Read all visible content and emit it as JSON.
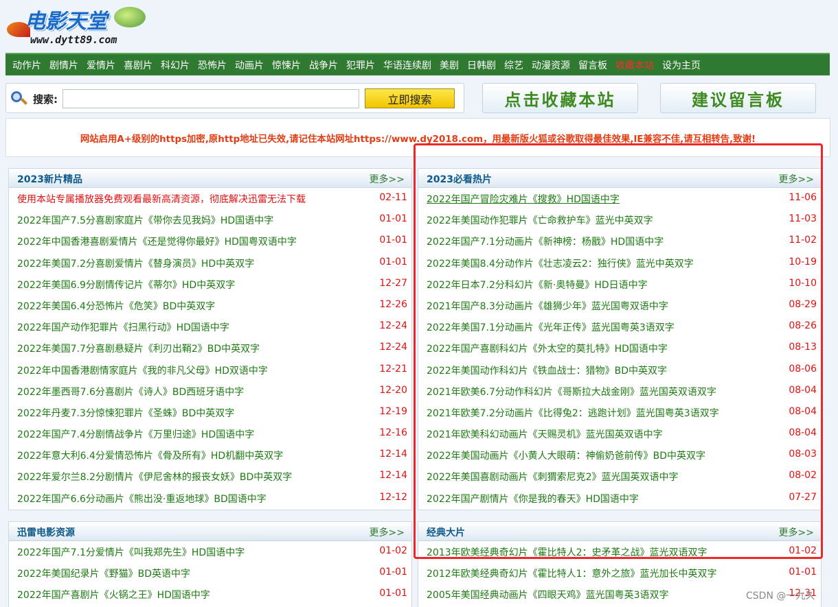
{
  "logo": {
    "title": "电影天堂",
    "url": "www.dytt89.com"
  },
  "nav": [
    "动作片",
    "剧情片",
    "爱情片",
    "喜剧片",
    "科幻片",
    "恐怖片",
    "动画片",
    "惊悚片",
    "战争片",
    "犯罪片",
    "华语连续剧",
    "美剧",
    "日韩剧",
    "综艺",
    "动漫资源",
    "留言板",
    "收藏本站",
    "设为主页"
  ],
  "search": {
    "label": "搜索:",
    "value": "",
    "button": "立即搜索"
  },
  "buttons": {
    "fav": "点击收藏本站",
    "msg": "建议留言板"
  },
  "notice": "网站启用A+级别的https加密,原http地址已失效,请记住本站网址https://www.dy2018.com，用最新版火狐或谷歌取得最佳效果,IE兼容不佳,请互相转告,致谢!",
  "panels": {
    "new2023": {
      "title": "2023新片精品",
      "more": "更多>>",
      "items": [
        {
          "title": "使用本站专属播放器免费观看最新高清资源，彻底解决迅雷无法下载",
          "date": "02-11"
        },
        {
          "title": "2022年国产7.5分喜剧家庭片《带你去见我妈》HD国语中字",
          "date": "01-01"
        },
        {
          "title": "2022年中国香港喜剧爱情片《还是觉得你最好》HD国粤双语中字",
          "date": "01-01"
        },
        {
          "title": "2022年美国7.2分喜剧爱情片《替身演员》HD中英双字",
          "date": "01-01"
        },
        {
          "title": "2022年美国6.9分剧情传记片《蒂尔》HD中英双字",
          "date": "12-27"
        },
        {
          "title": "2022年美国6.4分恐怖片《危笑》BD中英双字",
          "date": "12-26"
        },
        {
          "title": "2022年国产动作犯罪片《扫黑行动》HD国语中字",
          "date": "12-24"
        },
        {
          "title": "2022年美国7.7分喜剧悬疑片《利刃出鞘2》BD中英双字",
          "date": "12-24"
        },
        {
          "title": "2022年中国香港剧情家庭片《我的非凡父母》HD双语中字",
          "date": "12-21"
        },
        {
          "title": "2022年墨西哥7.6分喜剧片《诗人》BD西班牙语中字",
          "date": "12-20"
        },
        {
          "title": "2022年丹麦7.3分惊悚犯罪片《圣蛛》BD中英双字",
          "date": "12-19"
        },
        {
          "title": "2022年国产7.4分剧情战争片《万里归途》HD国语中字",
          "date": "12-16"
        },
        {
          "title": "2022年意大利6.4分爱情恐怖片《骨及所有》HD机翻中英双字",
          "date": "12-14"
        },
        {
          "title": "2022年爱尔兰8.2分剧情片《伊尼舍林的报丧女妖》BD中英双字",
          "date": "12-14"
        },
        {
          "title": "2022年国产6.6分动画片《熊出没·重返地球》BD国语中字",
          "date": "12-12"
        }
      ]
    },
    "hot2023": {
      "title": "2023必看热片",
      "more": "更多>>",
      "items": [
        {
          "title": "2022年国产冒险灾难片《搜救》HD国语中字",
          "date": "11-06"
        },
        {
          "title": "2022年美国动作犯罪片《亡命救护车》蓝光中英双字",
          "date": "11-03"
        },
        {
          "title": "2022年国产7.1分动画片《新神榜：杨戬》HD国语中字",
          "date": "11-02"
        },
        {
          "title": "2022年美国8.4分动作片《壮志凌云2：独行侠》蓝光中英双字",
          "date": "10-19"
        },
        {
          "title": "2022年日本7.2分科幻片《新·奥特曼》HD日语中字",
          "date": "10-10"
        },
        {
          "title": "2021年国产8.3分动画片《雄狮少年》蓝光国粤双语中字",
          "date": "08-29"
        },
        {
          "title": "2022年美国7.1分动画片《光年正传》蓝光国粤英3语双字",
          "date": "08-26"
        },
        {
          "title": "2022年国产喜剧科幻片《外太空的莫扎特》HD国语中字",
          "date": "08-13"
        },
        {
          "title": "2022年美国动作科幻片《铁血战士：猎物》BD中英双字",
          "date": "08-06"
        },
        {
          "title": "2021年欧美6.7分动作科幻片《哥斯拉大战金刚》蓝光国英双语双字",
          "date": "08-04"
        },
        {
          "title": "2021年欧美7.2分动画片《比得兔2：逃跑计划》蓝光国粤英3语双字",
          "date": "08-04"
        },
        {
          "title": "2021年欧美科幻动画片《天赐灵机》蓝光国英双语中字",
          "date": "08-04"
        },
        {
          "title": "2022年美国动画片《小黄人大眼萌：神偷奶爸前传》BD中英双字",
          "date": "08-03"
        },
        {
          "title": "2022年美国喜剧动画片《刺猬索尼克2》蓝光国英双语中字",
          "date": "08-02"
        },
        {
          "title": "2022年国产剧情片《你是我的春天》HD国语中字",
          "date": "07-27"
        }
      ]
    },
    "xunlei": {
      "title": "迅雷电影资源",
      "more": "更多>>",
      "items": [
        {
          "title": "2022年国产7.1分爱情片《叫我郑先生》HD国语中字",
          "date": "01-02"
        },
        {
          "title": "2022年美国纪录片《野猫》BD英语中字",
          "date": "01-01"
        },
        {
          "title": "2022年国产喜剧片《火锅之王》HD国语中字",
          "date": "01-01"
        }
      ]
    },
    "classic": {
      "title": "经典大片",
      "more": "更多>>",
      "items": [
        {
          "title": "2013年欧美经典奇幻片《霍比特人2：史矛革之战》蓝光双语双字",
          "date": "01-02"
        },
        {
          "title": "2012年欧美经典奇幻片《霍比特人1：意外之旅》蓝光加长中英双字",
          "date": "01-01"
        },
        {
          "title": "2005年美国经典动画片《四眼天鸡》蓝光国粤英3语双字",
          "date": "12-31"
        }
      ]
    }
  },
  "watermark": "CSDN @一九久",
  "colors": {
    "nav_bg": "#2f7a30",
    "link": "#1d7a12",
    "date": "#e01010",
    "highlight_frame": "#f0272a"
  }
}
